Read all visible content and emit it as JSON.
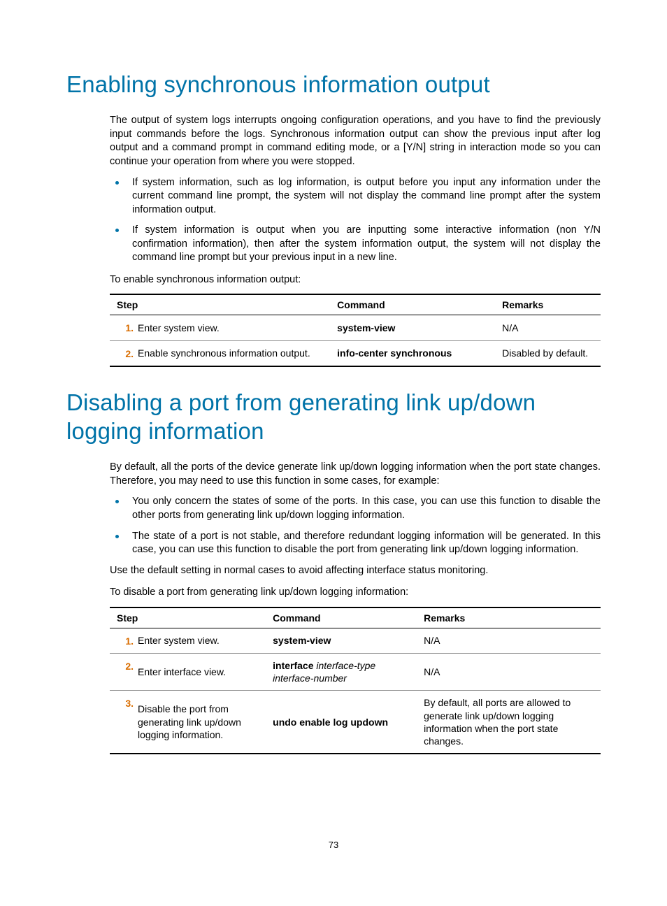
{
  "section1": {
    "heading": "Enabling synchronous information output",
    "para1": "The output of system logs interrupts ongoing configuration operations, and you have to find the previously input commands before the logs. Synchronous information output can show the previous input after log output and a command prompt in command editing mode, or a [Y/N] string in interaction mode so you can continue your operation from where you were stopped.",
    "bullets": [
      "If system information, such as log information, is output before you input any information under the current command line prompt, the system will not display the command line prompt after the system information output.",
      "If system information is output when you are inputting some interactive information (non Y/N confirmation information), then after the system information output, the system will not display the command line prompt but your previous input in a new line."
    ],
    "leadin": "To enable synchronous information output:",
    "table": {
      "headers": [
        "Step",
        "Command",
        "Remarks"
      ],
      "rows": [
        {
          "num": "1.",
          "step": "Enter system view.",
          "cmd_bold": "system-view",
          "cmd_italic": "",
          "remarks": "N/A"
        },
        {
          "num": "2.",
          "step": "Enable synchronous information output.",
          "cmd_bold": "info-center synchronous",
          "cmd_italic": "",
          "remarks": "Disabled by default."
        }
      ]
    }
  },
  "section2": {
    "heading": "Disabling a port from generating link up/down logging information",
    "para1": "By default, all the ports of the device generate link up/down logging information when the port state changes. Therefore, you may need to use this function in some cases, for example:",
    "bullets": [
      "You only concern the states of some of the ports. In this case, you can use this function to disable the other ports from generating link up/down logging information.",
      "The state of a port is not stable, and therefore redundant logging information will be generated. In this case, you can use this function to disable the port from generating link up/down logging information."
    ],
    "para2": "Use the default setting in normal cases to avoid affecting interface status monitoring.",
    "leadin": "To disable a port from generating link up/down logging information:",
    "table": {
      "headers": [
        "Step",
        "Command",
        "Remarks"
      ],
      "rows": [
        {
          "num": "1.",
          "step": "Enter system view.",
          "cmd_bold": "system-view",
          "cmd_italic": "",
          "remarks": "N/A"
        },
        {
          "num": "2.",
          "step": "Enter interface view.",
          "cmd_bold": "interface",
          "cmd_italic": " interface-type interface-number",
          "remarks": "N/A"
        },
        {
          "num": "3.",
          "step": "Disable the port from generating link up/down logging information.",
          "cmd_bold": "undo enable log updown",
          "cmd_italic": "",
          "remarks": "By default, all ports are allowed to generate link up/down logging information when the port state changes."
        }
      ]
    }
  },
  "pageNumber": "73"
}
